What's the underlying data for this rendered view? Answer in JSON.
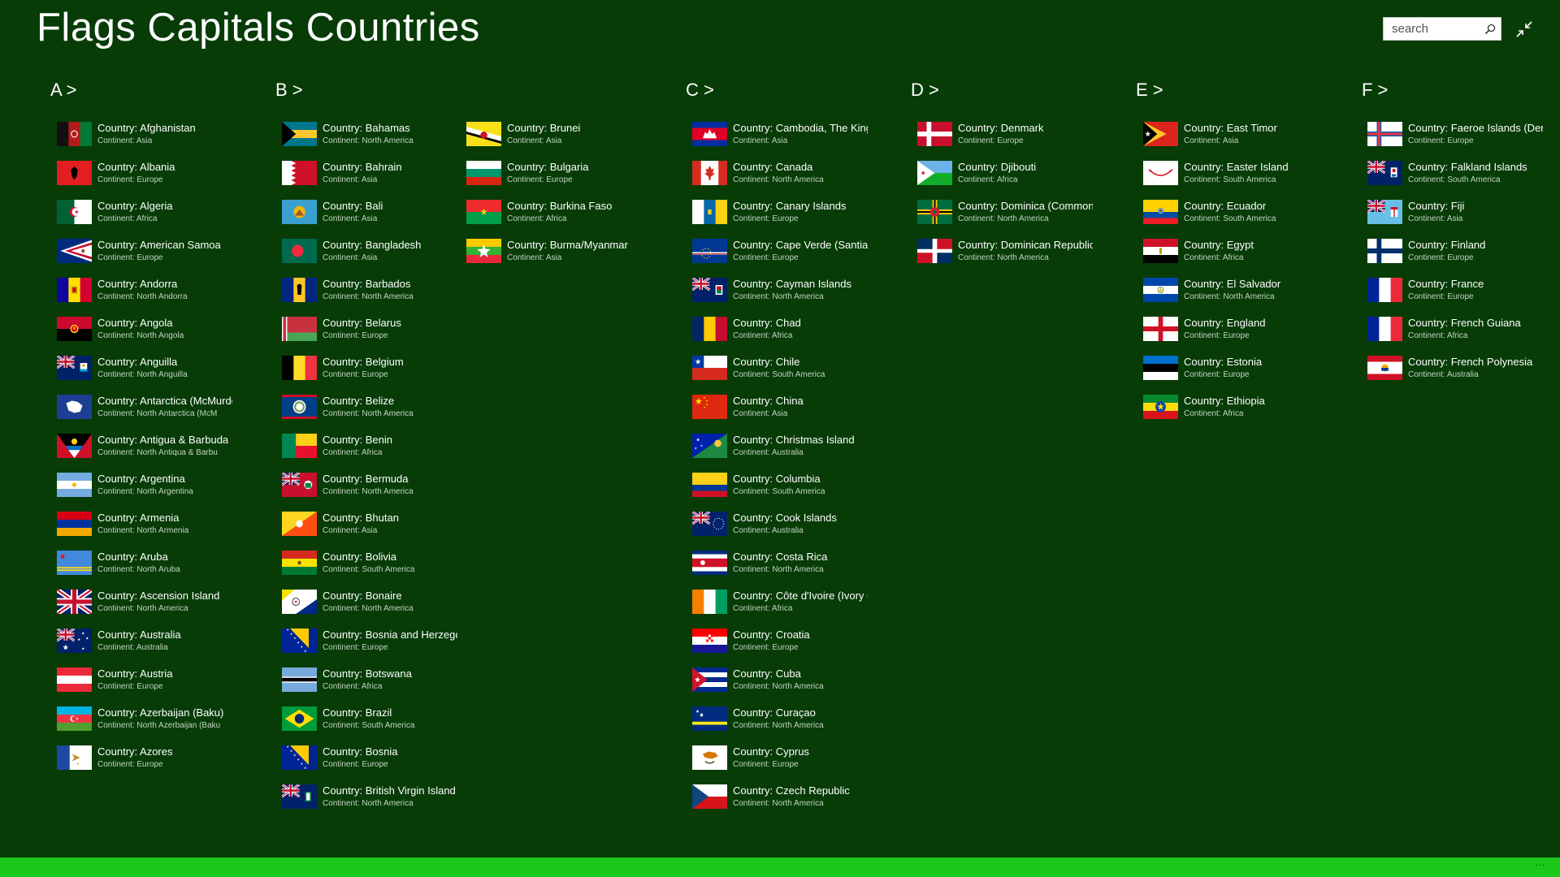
{
  "app": {
    "title": "Flags Capitals Countries"
  },
  "search": {
    "placeholder": "search"
  },
  "appbar": {
    "more_label": "..."
  },
  "groups": [
    {
      "header": "A >",
      "items": [
        {
          "country": "Country: Afghanistan",
          "continent": "Continent: Asia",
          "flag": "afghanistan-flag"
        },
        {
          "country": "Country: Albania",
          "continent": "Continent: Europe",
          "flag": "albania-flag"
        },
        {
          "country": "Country: Algeria",
          "continent": "Continent: Africa",
          "flag": "algeria-flag"
        },
        {
          "country": "Country: American Samoa",
          "continent": "Continent: Europe",
          "flag": "american-samoa-flag"
        },
        {
          "country": "Country: Andorra",
          "continent": "Continent: North Andorra",
          "flag": "andorra-flag"
        },
        {
          "country": "Country: Angola",
          "continent": "Continent: North Angola",
          "flag": "angola-flag"
        },
        {
          "country": "Country: Anguilla",
          "continent": "Continent: North Anguilla",
          "flag": "anguilla-flag"
        },
        {
          "country": "Country: Antarctica (McMurdo",
          "continent": "Continent: North Antarctica (McM",
          "flag": "antarctica-flag"
        },
        {
          "country": "Country: Antigua & Barbuda",
          "continent": "Continent: North Antiqua & Barbu",
          "flag": "antigua-barbuda-flag"
        },
        {
          "country": "Country: Argentina",
          "continent": "Continent: North Argentina",
          "flag": "argentina-flag"
        },
        {
          "country": "Country: Armenia",
          "continent": "Continent: North Armenia",
          "flag": "armenia-flag"
        },
        {
          "country": "Country: Aruba",
          "continent": "Continent: North Aruba",
          "flag": "aruba-flag"
        },
        {
          "country": "Country: Ascension Island",
          "continent": "Continent: North America",
          "flag": "ascension-island-flag"
        },
        {
          "country": "Country: Australia",
          "continent": "Continent: Australia",
          "flag": "australia-flag"
        },
        {
          "country": "Country: Austria",
          "continent": "Continent: Europe",
          "flag": "austria-flag"
        },
        {
          "country": "Country: Azerbaijan (Baku)",
          "continent": "Continent: North Azerbaijan (Baku",
          "flag": "azerbaijan-flag"
        },
        {
          "country": "Country: Azores",
          "continent": "Continent: Europe",
          "flag": "azores-flag"
        }
      ]
    },
    {
      "header": "B >",
      "items": [
        {
          "country": "Country: Bahamas",
          "continent": "Continent: North America",
          "flag": "bahamas-flag"
        },
        {
          "country": "Country: Bahrain",
          "continent": "Continent: Asia",
          "flag": "bahrain-flag"
        },
        {
          "country": "Country: Bali",
          "continent": "Continent: Asia",
          "flag": "bali-flag"
        },
        {
          "country": "Country: Bangladesh",
          "continent": "Continent: Asia",
          "flag": "bangladesh-flag"
        },
        {
          "country": "Country: Barbados",
          "continent": "Continent: North America",
          "flag": "barbados-flag"
        },
        {
          "country": "Country: Belarus",
          "continent": "Continent: Europe",
          "flag": "belarus-flag"
        },
        {
          "country": "Country: Belgium",
          "continent": "Continent: Europe",
          "flag": "belgium-flag"
        },
        {
          "country": "Country: Belize",
          "continent": "Continent: North America",
          "flag": "belize-flag"
        },
        {
          "country": "Country: Benin",
          "continent": "Continent: Africa",
          "flag": "benin-flag"
        },
        {
          "country": "Country: Bermuda",
          "continent": "Continent: North America",
          "flag": "bermuda-flag"
        },
        {
          "country": "Country: Bhutan",
          "continent": "Continent: Asia",
          "flag": "bhutan-flag"
        },
        {
          "country": "Country: Bolivia",
          "continent": "Continent: South America",
          "flag": "bolivia-flag"
        },
        {
          "country": "Country: Bonaire",
          "continent": "Continent: North America",
          "flag": "bonaire-flag"
        },
        {
          "country": "Country: Bosnia and Herzegovina",
          "continent": "Continent: Europe",
          "flag": "bosnia-herzegovina-flag"
        },
        {
          "country": "Country: Botswana",
          "continent": "Continent: Africa",
          "flag": "botswana-flag"
        },
        {
          "country": "Country: Brazil",
          "continent": "Continent: South America",
          "flag": "brazil-flag"
        },
        {
          "country": "Country: Bosnia",
          "continent": "Continent: Europe",
          "flag": "bosnia-flag"
        },
        {
          "country": "Country: British Virgin Island",
          "continent": "Continent: North America",
          "flag": "british-virgin-islands-flag"
        },
        {
          "country": "Country: Brunei",
          "continent": "Continent: Asia",
          "flag": "brunei-flag"
        },
        {
          "country": "Country: Bulgaria",
          "continent": "Continent: Europe",
          "flag": "bulgaria-flag"
        },
        {
          "country": "Country: Burkina Faso",
          "continent": "Continent: Africa",
          "flag": "burkina-faso-flag"
        },
        {
          "country": "Country: Burma/Myanmar",
          "continent": "Continent: Asia",
          "flag": "myanmar-flag"
        }
      ]
    },
    {
      "header": "C >",
      "items": [
        {
          "country": "Country: Cambodia, The Kingdom of",
          "continent": "Continent: Asia",
          "flag": "cambodia-flag"
        },
        {
          "country": "Country: Canada",
          "continent": "Continent: North America",
          "flag": "canada-flag"
        },
        {
          "country": "Country: Canary Islands",
          "continent": "Continent: Europe",
          "flag": "canary-islands-flag"
        },
        {
          "country": "Country: Cape Verde (Santiago)",
          "continent": "Continent: Europe",
          "flag": "cape-verde-flag"
        },
        {
          "country": "Country: Cayman Islands",
          "continent": "Continent: North America",
          "flag": "cayman-islands-flag"
        },
        {
          "country": "Country: Chad",
          "continent": "Continent: Africa",
          "flag": "chad-flag"
        },
        {
          "country": "Country: Chile",
          "continent": "Continent: South America",
          "flag": "chile-flag"
        },
        {
          "country": "Country: China",
          "continent": "Continent: Asia",
          "flag": "china-flag"
        },
        {
          "country": "Country: Christmas Island",
          "continent": "Continent: Australia",
          "flag": "christmas-island-flag"
        },
        {
          "country": "Country: Columbia",
          "continent": "Continent: South America",
          "flag": "colombia-flag"
        },
        {
          "country": "Country: Cook Islands",
          "continent": "Continent: Australia",
          "flag": "cook-islands-flag"
        },
        {
          "country": "Country: Costa Rica",
          "continent": "Continent: North America",
          "flag": "costa-rica-flag"
        },
        {
          "country": "Country: Côte d'Ivoire (Ivory Coast)",
          "continent": "Continent: Africa",
          "flag": "ivory-coast-flag"
        },
        {
          "country": "Country: Croatia",
          "continent": "Continent: Europe",
          "flag": "croatia-flag"
        },
        {
          "country": "Country: Cuba",
          "continent": "Continent: North America",
          "flag": "cuba-flag"
        },
        {
          "country": "Country: Curaçao",
          "continent": "Continent: North America",
          "flag": "curacao-flag"
        },
        {
          "country": "Country: Cyprus",
          "continent": "Continent: Europe",
          "flag": "cyprus-flag"
        },
        {
          "country": "Country: Czech Republic",
          "continent": "Continent: North America",
          "flag": "czech-republic-flag"
        }
      ]
    },
    {
      "header": "D >",
      "items": [
        {
          "country": "Country: Denmark",
          "continent": "Continent: Europe",
          "flag": "denmark-flag"
        },
        {
          "country": "Country: Djibouti",
          "continent": "Continent: Africa",
          "flag": "djibouti-flag"
        },
        {
          "country": "Country: Dominica (Commonwealth)",
          "continent": "Continent: North America",
          "flag": "dominica-flag"
        },
        {
          "country": "Country: Dominican Republic",
          "continent": "Continent: North America",
          "flag": "dominican-republic-flag"
        }
      ]
    },
    {
      "header": "E >",
      "items": [
        {
          "country": "Country: East Timor",
          "continent": "Continent: Asia",
          "flag": "east-timor-flag"
        },
        {
          "country": "Country: Easter Island",
          "continent": "Continent: South America",
          "flag": "easter-island-flag"
        },
        {
          "country": "Country: Ecuador",
          "continent": "Continent: South America",
          "flag": "ecuador-flag"
        },
        {
          "country": "Country: Egypt",
          "continent": "Continent: Africa",
          "flag": "egypt-flag"
        },
        {
          "country": "Country: El Salvador",
          "continent": "Continent: North America",
          "flag": "el-salvador-flag"
        },
        {
          "country": "Country: England",
          "continent": "Continent: Europe",
          "flag": "england-flag"
        },
        {
          "country": "Country: Estonia",
          "continent": "Continent: Europe",
          "flag": "estonia-flag"
        },
        {
          "country": "Country: Ethiopia",
          "continent": "Continent: Africa",
          "flag": "ethiopia-flag"
        }
      ]
    },
    {
      "header": "F >",
      "items": [
        {
          "country": "Country: Faeroe Islands (Denmark)",
          "continent": "Continent: Europe",
          "flag": "faroe-islands-flag"
        },
        {
          "country": "Country: Falkland Islands",
          "continent": "Continent: South America",
          "flag": "falkland-islands-flag"
        },
        {
          "country": "Country: Fiji",
          "continent": "Continent: Asia",
          "flag": "fiji-flag"
        },
        {
          "country": "Country: Finland",
          "continent": "Continent: Europe",
          "flag": "finland-flag"
        },
        {
          "country": "Country: France",
          "continent": "Continent: Europe",
          "flag": "france-flag"
        },
        {
          "country": "Country: French Guiana",
          "continent": "Continent: Africa",
          "flag": "french-guiana-flag"
        },
        {
          "country": "Country: French Polynesia",
          "continent": "Continent: Australia",
          "flag": "french-polynesia-flag"
        }
      ]
    }
  ]
}
